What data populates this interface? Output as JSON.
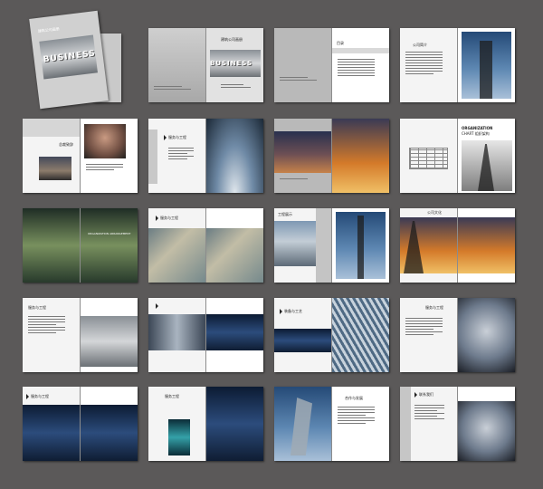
{
  "cover": {
    "small_title": "建筑公司画册",
    "big_word": "BUSINESS"
  },
  "spreads": {
    "s1": {
      "right_title": "建筑公司画册",
      "big_word": "BUSINESS"
    },
    "s2": {
      "heading": "目录"
    },
    "s3": {
      "heading": "公司简介"
    },
    "s4": {
      "heading": "总裁致辞"
    },
    "s5": {
      "heading": "服务与工程"
    },
    "s6": {
      "heading_line1": "ORGANIZATION",
      "heading_line2": "CHART 组织架构"
    },
    "s7": {
      "heading": "ORGANIZATION  ARRANGEMENT"
    },
    "s8": {
      "heading": "服务与工程"
    },
    "s9": {
      "heading": "工程展示"
    },
    "s10": {
      "heading": "公司文化"
    },
    "s11": {
      "heading": "服务与工程"
    },
    "s12": {
      "heading": "装备与工艺"
    },
    "s13": {
      "heading": "服务与工程"
    },
    "s14": {
      "heading": "服务与工程"
    },
    "s15": {
      "heading": "服务工程"
    },
    "s16": {
      "heading": "合作与发展"
    },
    "s17": {
      "heading": "联系我们"
    }
  }
}
